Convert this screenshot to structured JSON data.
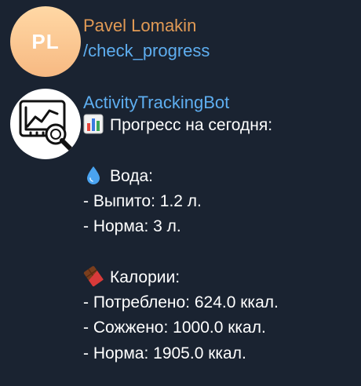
{
  "messages": [
    {
      "sender": "Pavel Lomakin",
      "avatar_initials": "PL",
      "text": "/check_progress"
    },
    {
      "sender": "ActivityTrackingBot",
      "avatar_icon": "chart-magnifier-icon",
      "lines": {
        "title": "Прогресс на сегодня:",
        "water_header": "Вода:",
        "water_drunk": "- Выпито: 1.2 л.",
        "water_norm": "- Норма: 3 л.",
        "cal_header": "Калории:",
        "cal_consumed": "- Потреблено: 624.0 ккал.",
        "cal_burned": "- Сожжено: 1000.0 ккал.",
        "cal_norm": "- Норма: 1905.0 ккал."
      }
    }
  ],
  "colors": {
    "background": "#1a2331",
    "sender_pavel": "#e19a55",
    "sender_bot": "#5eaef0",
    "link": "#5eaef0",
    "avatar_pl": "#f7b982"
  },
  "emoji_icons": [
    "bar-chart-emoji-icon",
    "water-drop-emoji-icon",
    "chocolate-bar-emoji-icon"
  ]
}
